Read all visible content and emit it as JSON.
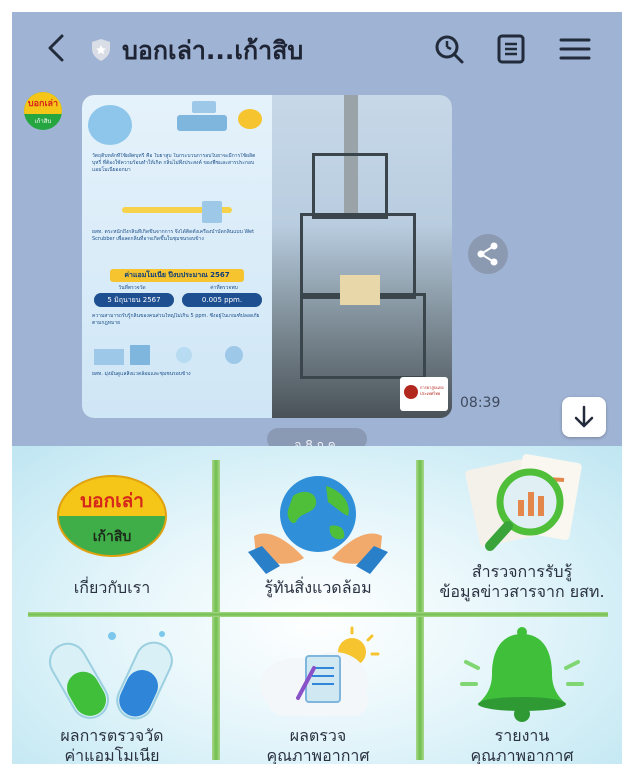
{
  "header": {
    "title": "บอกเล่า...เก้าสิบ",
    "icons": [
      "back-arrow-icon",
      "shield-icon",
      "search-icon",
      "notes-icon",
      "menu-icon"
    ]
  },
  "chat": {
    "avatar_line1": "บอกเล่า",
    "avatar_line2": "เก้าสิบ",
    "time": "08:39",
    "date_pill": "จ 8 ก.ค.",
    "poster": {
      "intro": "วัตถุดิบหลักที่ใช้ผลิตบุหรี่ คือ ใบยาสูบ ในกระบวนการอบใบยาจะมีการใช้ผลิตบุหรี่ ที่ต้องใช้ความร้อนทำให้เกิด กลิ่นไม่พึงประสงค์ ของพืชและสารประกอบแอมโมเนียออกมา",
      "middle": "ยสท. ตระหนักถึงกลิ่นที่เกิดขึ้นจากการ จึงได้ติดตั้งเครื่องบำบัดกลิ่นแบบ Wet Scrubber เพื่อลดกลิ่นที่อาจเกิดขึ้นในชุมชนรอบข้าง",
      "banner": "ค่าแอมโมเนีย ปีงบประมาณ 2567",
      "col1_label": "วันที่ตรวจวัด",
      "col2_label": "ค่าที่ตรวจพบ",
      "date_value": "5 มิถุนายน 2567",
      "ppm_value": "0.005 ppm.",
      "lower": "ความสามารถรับรู้กลิ่นของคนส่วนใหญ่ไม่เกิน 5 ppm. ซึ่งอยู่ในเกณฑ์ปลอดภัยตามกฎหมาย",
      "footer": "ยสท. มุ่งมั่นดูแลสิ่งแวดล้อมและชุมชนรอบข้าง",
      "org": "การยาสูบแห่งประเทศไทย"
    }
  },
  "rich_menu": {
    "items": [
      {
        "label1": "เกี่ยวกับเรา",
        "label2": "",
        "logo_top": "บอกเล่า",
        "logo_bottom": "เก้าสิบ"
      },
      {
        "label1": "รู้ทันสิ่งแวดล้อม",
        "label2": ""
      },
      {
        "label1": "สำรวจการรับรู้",
        "label2": "ข้อมูลข่าวสารจาก ยสท."
      },
      {
        "label1": "ผลการตรวจวัด",
        "label2": "ค่าแอมโมเนีย"
      },
      {
        "label1": "ผลตรวจ",
        "label2": "คุณภาพอากาศ"
      },
      {
        "label1": "รายงาน",
        "label2": "คุณภาพอากาศ"
      }
    ]
  },
  "colors": {
    "chat_background": "#9fb3d4",
    "menu_background": "#e6f6fb",
    "bamboo": "#6fbf4c"
  }
}
